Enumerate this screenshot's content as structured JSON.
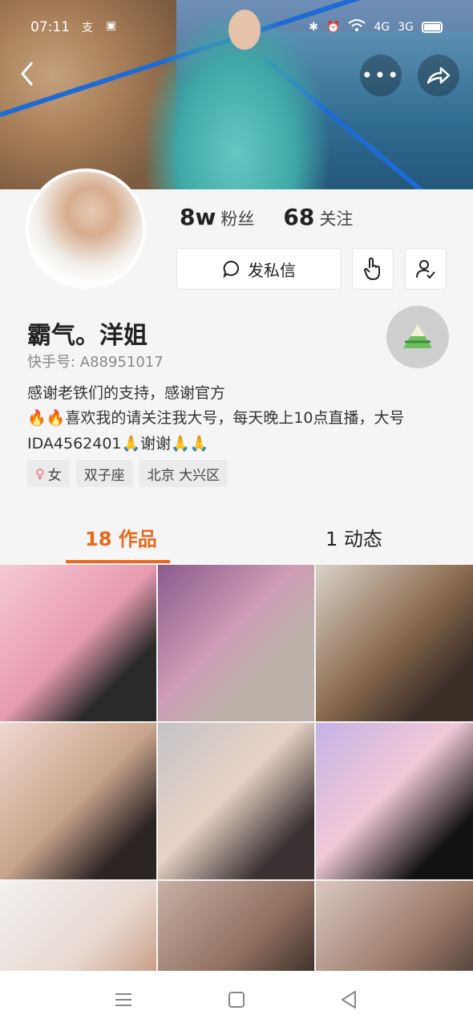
{
  "status_bar": {
    "time": "07:11",
    "network_1": "4G",
    "network_2": "3G"
  },
  "profile": {
    "followers_count": "8w",
    "followers_label": "粉丝",
    "following_count": "68",
    "following_label": "关注",
    "message_button": "发私信",
    "name": "霸气。洋姐",
    "kuaishou_id": "快手号: A88951017",
    "bio_line1": "感谢老铁们的支持，感谢官方",
    "bio_line2": "🔥🔥喜欢我的请关注我大号，每天晚上10点直播，大号IDA4562401🙏谢谢🙏🙏",
    "tags": {
      "gender": "女",
      "zodiac": "双子座",
      "location": "北京 大兴区"
    }
  },
  "tabs": {
    "works": "18 作品",
    "moments": "1 动态"
  },
  "icons": {
    "back": "back-icon",
    "more": "more-icon",
    "share": "share-icon",
    "message": "chat-bubble-icon",
    "poke": "hand-tap-icon",
    "follow": "user-check-icon",
    "gender": "female-icon",
    "nav_menu": "menu-icon",
    "nav_home": "home-icon",
    "nav_back": "back-triangle-icon"
  },
  "colors": {
    "accent": "#e8691d"
  }
}
